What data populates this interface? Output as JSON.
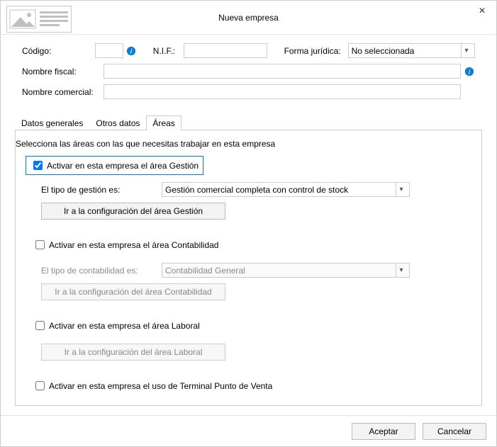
{
  "title": "Nueva empresa",
  "fields": {
    "codigo_label": "Código:",
    "nif_label": "N.I.F.:",
    "forma_label": "Forma jurídica:",
    "forma_value": "No seleccionada",
    "nombre_fiscal_label": "Nombre fiscal:",
    "nombre_comercial_label": "Nombre comercial:"
  },
  "tabs": {
    "datos_generales": "Datos generales",
    "otros_datos": "Otros datos",
    "areas": "Áreas"
  },
  "intro": "Selecciona las áreas con las que necesitas trabajar en esta empresa",
  "gestion": {
    "check_label": "Activar en esta empresa el área Gestión",
    "tipo_label": "El tipo de gestión es:",
    "tipo_value": "Gestión comercial completa con control de stock",
    "config_btn": "Ir a la configuración del área Gestión"
  },
  "contab": {
    "check_label": "Activar en esta empresa el área Contabilidad",
    "tipo_label": "El tipo de contabilidad es:",
    "tipo_value": "Contabilidad General",
    "config_btn": "Ir a la configuración del área Contabilidad"
  },
  "laboral": {
    "check_label": "Activar en esta empresa el área Laboral",
    "config_btn": "Ir a la configuración del área Laboral"
  },
  "tpv": {
    "check_label": "Activar en esta empresa el uso de Terminal Punto de Venta"
  },
  "footer": {
    "accept": "Aceptar",
    "cancel": "Cancelar"
  }
}
